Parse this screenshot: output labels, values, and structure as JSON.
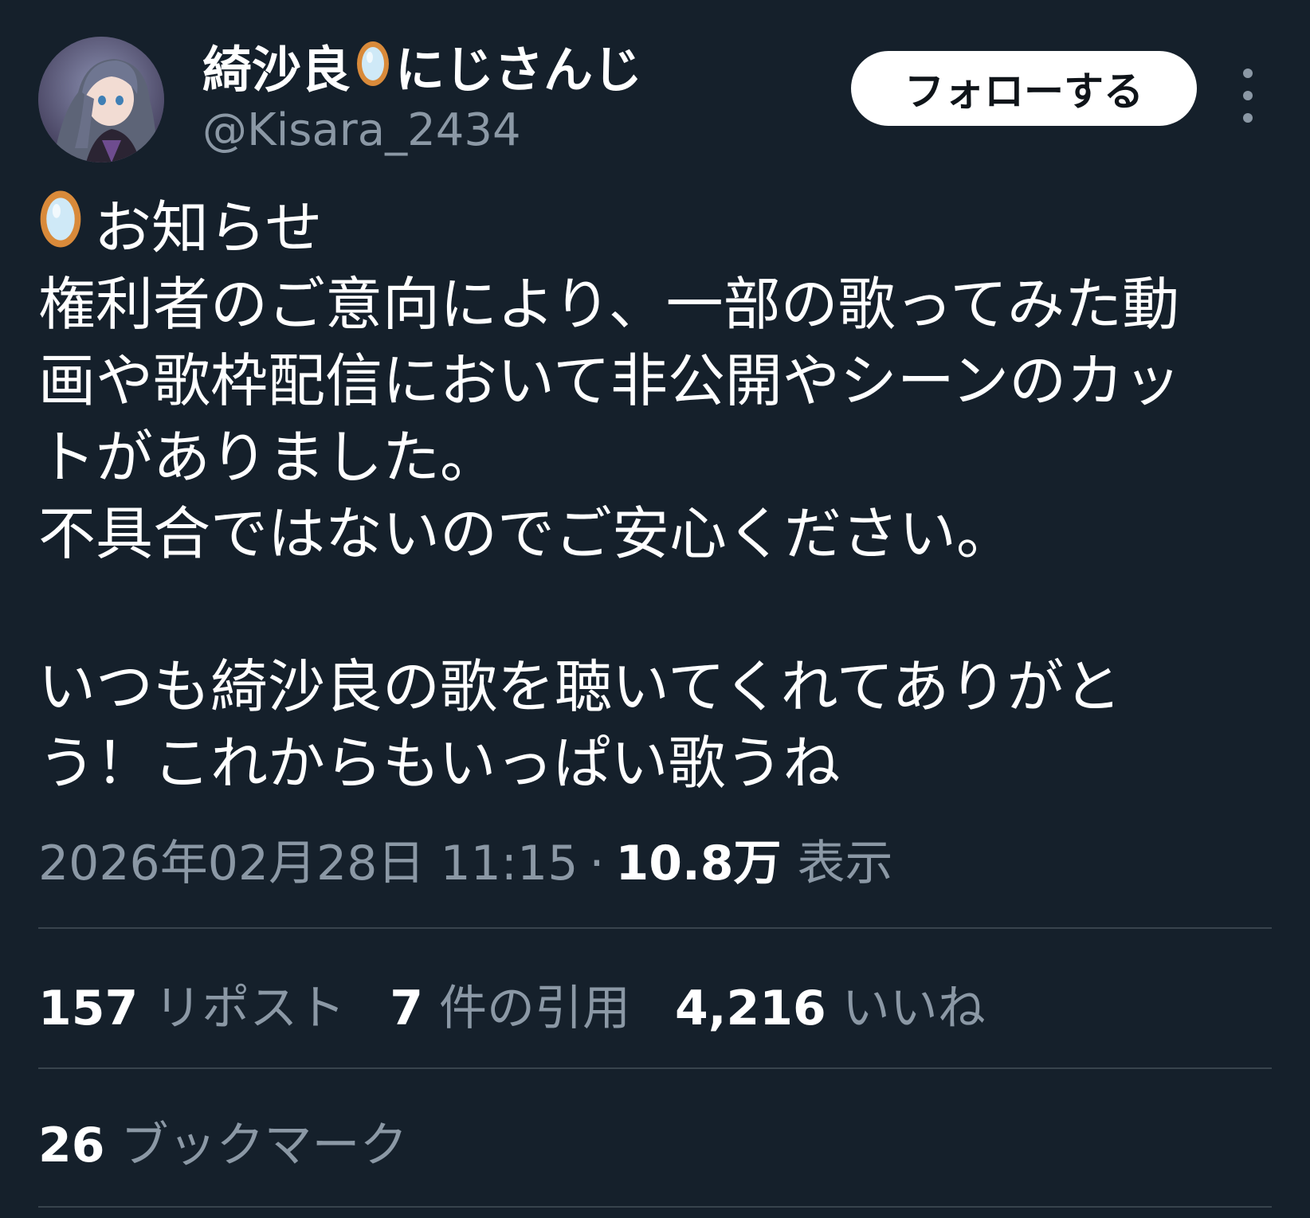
{
  "author": {
    "display_name_prefix": "綺沙良",
    "display_name_suffix": "にじさんじ",
    "name_emoji": "mirror-icon",
    "handle": "@Kisara_2434",
    "avatar": "avatar-illustration"
  },
  "follow_button_label": "フォローする",
  "more_button": "more-vertical-icon",
  "tweet": {
    "heading": "お知らせ",
    "heading_emoji": "mirror-icon",
    "lines": [
      "権利者のご意向により、一部の歌ってみた動",
      "画や歌枠配信において非公開やシーンのカッ",
      "トがありました。",
      "不具合ではないのでご安心ください。",
      "",
      "いつも綺沙良の歌を聴いてくれてありがと",
      "う！これからもいっぱい歌うね"
    ]
  },
  "meta": {
    "timestamp": "2026年02月28日 11:15",
    "separator": "·",
    "views_count": "10.8万",
    "views_label": "表示"
  },
  "stats": {
    "reposts": {
      "count": "157",
      "label": "リポスト"
    },
    "quotes": {
      "count": "7",
      "label": "件の引用"
    },
    "likes": {
      "count": "4,216",
      "label": "いいね"
    },
    "bookmarks": {
      "count": "26",
      "label": "ブックマーク"
    }
  },
  "colors": {
    "background": "#15202b",
    "text": "#ffffff",
    "secondary": "#8b98a5",
    "divider": "#38444d",
    "mirror_frame": "#d98a3a",
    "mirror_glass": "#cfe9f7"
  }
}
